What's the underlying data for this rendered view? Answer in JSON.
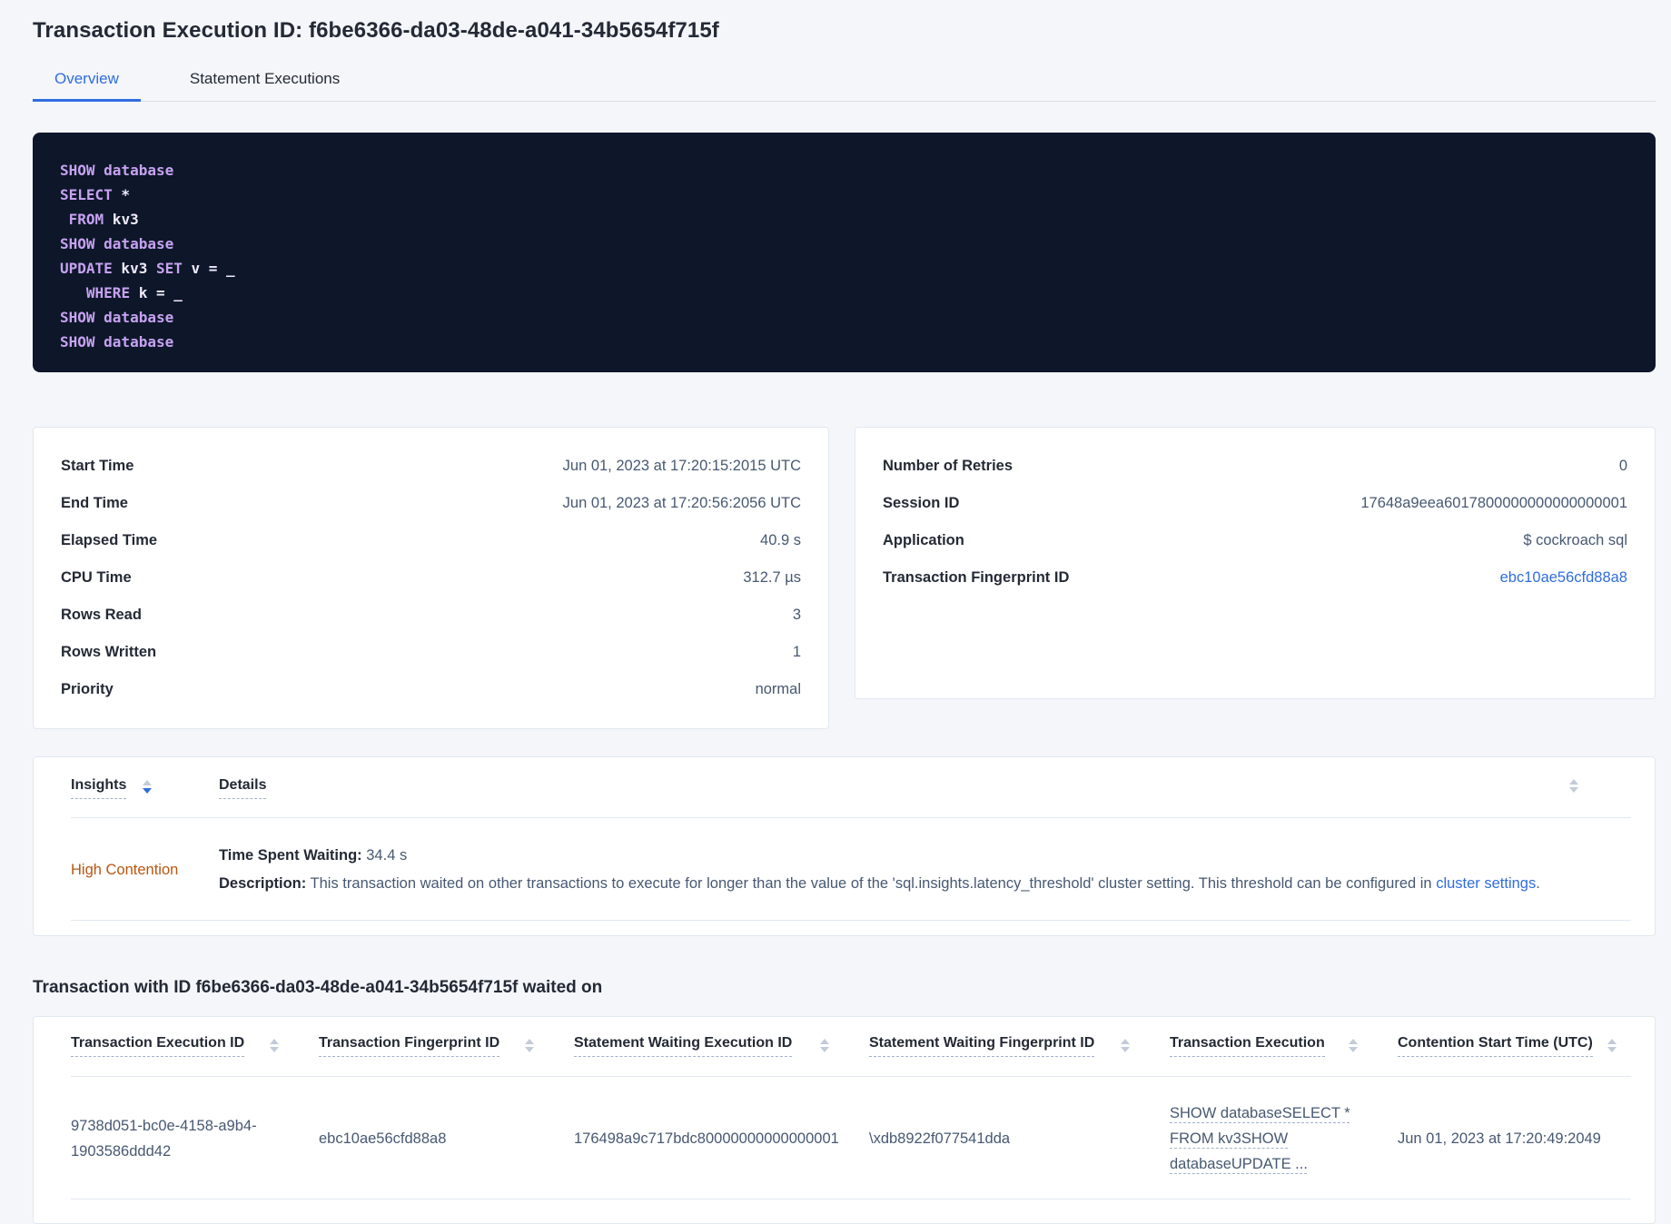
{
  "page": {
    "title": "Transaction Execution ID: f6be6366-da03-48de-a041-34b5654f715f"
  },
  "tabs": {
    "overview": "Overview",
    "statement_executions": "Statement Executions"
  },
  "sql": {
    "lines": [
      [
        "SHOW database"
      ],
      [
        "SELECT",
        " *"
      ],
      [
        " ",
        "FROM",
        " kv3"
      ],
      [
        "SHOW database"
      ],
      [
        "UPDATE",
        " kv3 ",
        "SET",
        " v = _"
      ],
      [
        "   ",
        "WHERE",
        " k = _"
      ],
      [
        "SHOW database"
      ],
      [
        "SHOW database"
      ]
    ]
  },
  "summary_left": {
    "rows": [
      {
        "label": "Start Time",
        "value": "Jun 01, 2023 at 17:20:15:2015 UTC"
      },
      {
        "label": "End Time",
        "value": "Jun 01, 2023 at 17:20:56:2056 UTC"
      },
      {
        "label": "Elapsed Time",
        "value": "40.9 s"
      },
      {
        "label": "CPU Time",
        "value": "312.7 µs"
      },
      {
        "label": "Rows Read",
        "value": "3"
      },
      {
        "label": "Rows Written",
        "value": "1"
      },
      {
        "label": "Priority",
        "value": "normal"
      }
    ]
  },
  "summary_right": {
    "rows": [
      {
        "label": "Number of Retries",
        "value": "0"
      },
      {
        "label": "Session ID",
        "value": "17648a9eea6017800000000000000001"
      },
      {
        "label": "Application",
        "value": "$ cockroach sql"
      }
    ],
    "fingerprint_label": "Transaction Fingerprint ID",
    "fingerprint_value": "ebc10ae56cfd88a8"
  },
  "insights_table": {
    "col_insights": "Insights",
    "col_details": "Details",
    "row": {
      "insight": "High Contention",
      "waiting_label": "Time Spent Waiting:",
      "waiting_value": " 34.4 s",
      "description_label": "Description:",
      "description_text": " This transaction waited on other transactions to execute for longer than the value of the 'sql.insights.latency_threshold' cluster setting. This threshold can be configured in ",
      "description_link": "cluster settings",
      "description_suffix": "."
    }
  },
  "waited_section": {
    "title": "Transaction with ID f6be6366-da03-48de-a041-34b5654f715f waited on",
    "columns": [
      {
        "label": "Transaction Execution ID"
      },
      {
        "label": "Transaction Fingerprint ID"
      },
      {
        "label": "Statement Waiting Execution ID"
      },
      {
        "label": "Statement Waiting Fingerprint ID"
      },
      {
        "label": "Transaction Execution"
      },
      {
        "label": "Contention Start Time (UTC)"
      }
    ],
    "row": {
      "transaction_execution_id": "9738d051-bc0e-4158-a9b4-1903586ddd42",
      "transaction_fingerprint_id": "ebc10ae56cfd88a8",
      "statement_waiting_execution_id": "176498a9c717bdc80000000000000001",
      "statement_waiting_fingerprint_id": "\\xdb8922f077541dda",
      "transaction_execution": "SHOW databaseSELECT * FROM kv3SHOW databaseUPDATE ...",
      "contention_start_time": "Jun 01, 2023 at 17:20:49:2049"
    }
  },
  "colors": {
    "accent": "#2f6de0",
    "warning": "#b8560f",
    "code_bg": "#0d1729",
    "code_keyword": "#c7a2f1",
    "code_plain": "#efeafc"
  }
}
